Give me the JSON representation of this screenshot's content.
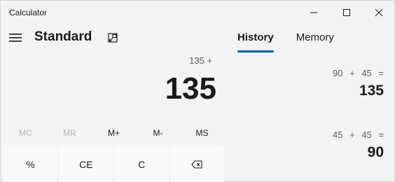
{
  "window": {
    "title": "Calculator",
    "controls": [
      "minimize-icon",
      "maximize-icon",
      "close-icon"
    ]
  },
  "header": {
    "mode": "Standard"
  },
  "display": {
    "expression": "135 +",
    "result": "135"
  },
  "memory": {
    "buttons": [
      {
        "label": "MC",
        "enabled": false
      },
      {
        "label": "MR",
        "enabled": false
      },
      {
        "label": "M+",
        "enabled": true
      },
      {
        "label": "M-",
        "enabled": true
      },
      {
        "label": "MS",
        "enabled": true
      }
    ]
  },
  "keypad": {
    "row1": [
      "%",
      "CE",
      "C",
      "backspace-icon"
    ]
  },
  "panel": {
    "tabs": [
      {
        "label": "History",
        "active": true
      },
      {
        "label": "Memory",
        "active": false
      }
    ],
    "accent": "#005fb8",
    "history": [
      {
        "expression": "90 + 45 =",
        "result": "135"
      },
      {
        "expression": "45 + 45 =",
        "result": "90"
      }
    ]
  }
}
